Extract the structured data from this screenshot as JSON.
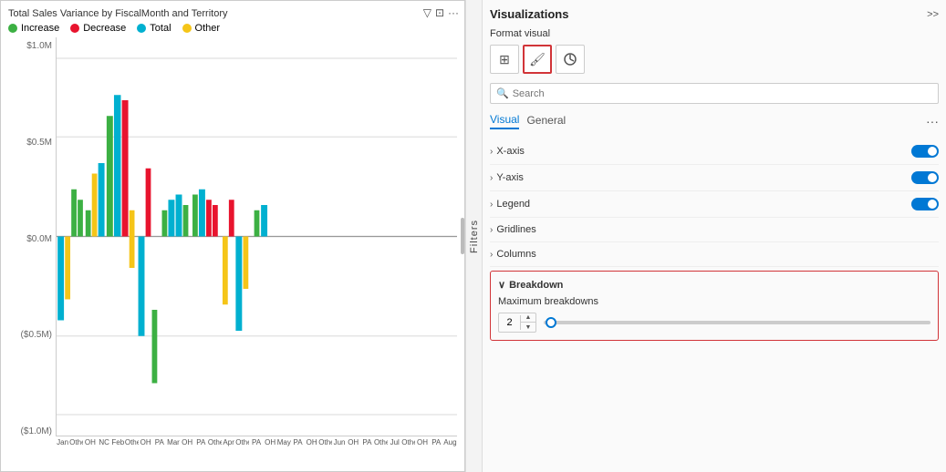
{
  "chart": {
    "title": "Total Sales Variance by FiscalMonth and Territory",
    "legend": [
      {
        "label": "Increase",
        "color": "#3cb043"
      },
      {
        "label": "Decrease",
        "color": "#e8142e"
      },
      {
        "label": "Total",
        "color": "#00b0d0"
      },
      {
        "label": "Other",
        "color": "#f5c518"
      }
    ],
    "yAxis": [
      "$1.0M",
      "$0.5M",
      "$0.0M",
      "($0.5M)",
      "($1.0M)"
    ],
    "xLabels": [
      "Jan",
      "Other",
      "OH",
      "NC",
      "Feb",
      "Other",
      "OH",
      "PA",
      "Mar",
      "OH",
      "PA",
      "Other",
      "Apr",
      "Other",
      "PA",
      "OH",
      "May",
      "PA",
      "OH",
      "Other",
      "Jun",
      "OH",
      "PA",
      "Other",
      "Jul",
      "Other",
      "OH",
      "PA",
      "Aug"
    ]
  },
  "panel": {
    "title": "Visualizations",
    "expand_label": ">>",
    "format_visual_label": "Format visual",
    "icons": [
      {
        "name": "table-icon",
        "symbol": "⊞"
      },
      {
        "name": "paint-icon",
        "symbol": "🖌"
      },
      {
        "name": "analytics-icon",
        "symbol": "📊"
      }
    ],
    "search": {
      "placeholder": "Search",
      "value": ""
    },
    "tabs": [
      {
        "label": "Visual",
        "active": true
      },
      {
        "label": "General",
        "active": false
      }
    ],
    "sections": [
      {
        "label": "X-axis",
        "toggle": true
      },
      {
        "label": "Y-axis",
        "toggle": true
      },
      {
        "label": "Legend",
        "toggle": true
      },
      {
        "label": "Gridlines",
        "toggle": false
      },
      {
        "label": "Columns",
        "toggle": false
      }
    ],
    "breakdown": {
      "label": "Breakdown",
      "max_label": "Maximum breakdowns",
      "value": "2"
    }
  },
  "filters": {
    "label": "Filters"
  }
}
